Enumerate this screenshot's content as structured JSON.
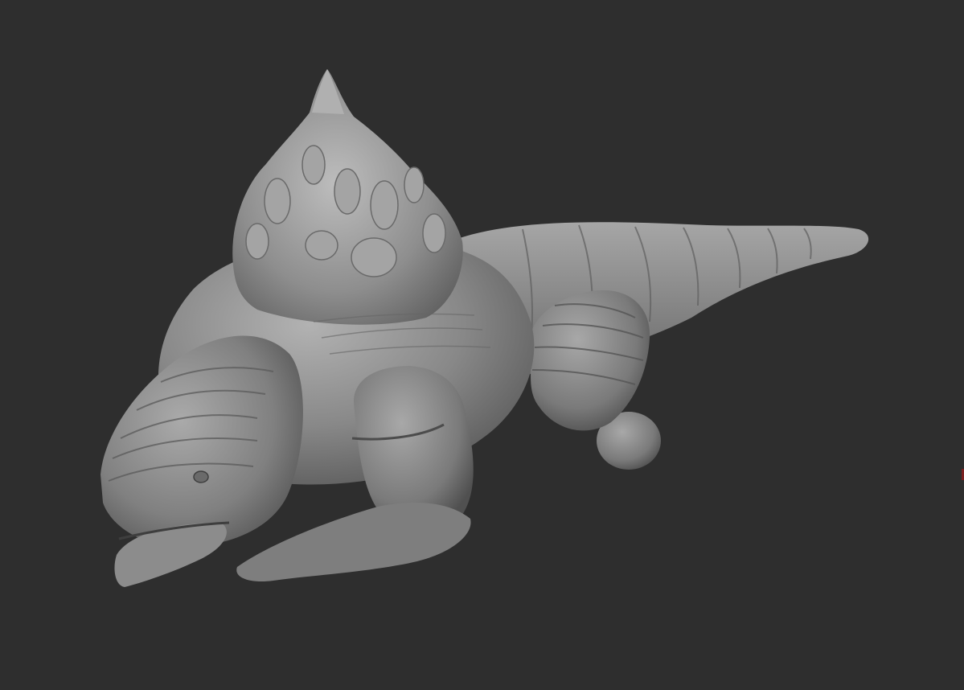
{
  "viewport": {
    "background": "#2e2e2e",
    "model_base_color": "#8a8a8a",
    "model_highlight_color": "#b4b4b4",
    "model_shadow_color": "#4a4a4a",
    "edge_mark_color": "#7a1f1f"
  },
  "model": {
    "subject": "sculpted-creature",
    "parts": [
      "crest",
      "head",
      "jaw",
      "eye",
      "body",
      "tail",
      "front-leg",
      "hind-leg",
      "front-foot",
      "hind-foot"
    ]
  }
}
